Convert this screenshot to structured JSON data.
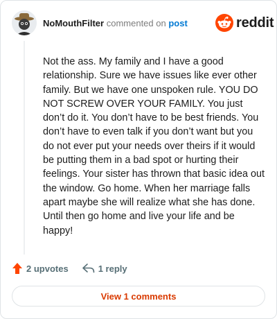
{
  "comment": {
    "username": "NoMouthFilter",
    "commented_text": "commented on",
    "post_link": "post",
    "avatar_icon": "cowboy-hat-avatar-icon",
    "body": "Not the ass. My family and I have a good relationship. Sure we have issues like ever other family. But we have one unspoken rule. YOU DO NOT SCREW OVER YOUR FAMILY. You just don’t do it. You don’t have to be best friends. You don’t have to even talk if you don’t want but you do not ever put your needs over theirs if it would be putting them in a bad spot or hurting their feelings. Your sister has thrown that basic idea out the window. Go home. When her marriage falls apart maybe she will realize what she has done. Until then go home and live your life and be happy!"
  },
  "brand": {
    "logo_text": "reddit",
    "logo_icon": "reddit-alien-icon",
    "accent_color": "#ff4500"
  },
  "actions": {
    "upvotes": "2 upvotes",
    "upvote_icon": "upvote-arrow-icon",
    "replies": "1 reply",
    "reply_icon": "reply-arrow-icon"
  },
  "footer": {
    "view_comments": "View 1 comments",
    "link_color": "#d93a00"
  }
}
